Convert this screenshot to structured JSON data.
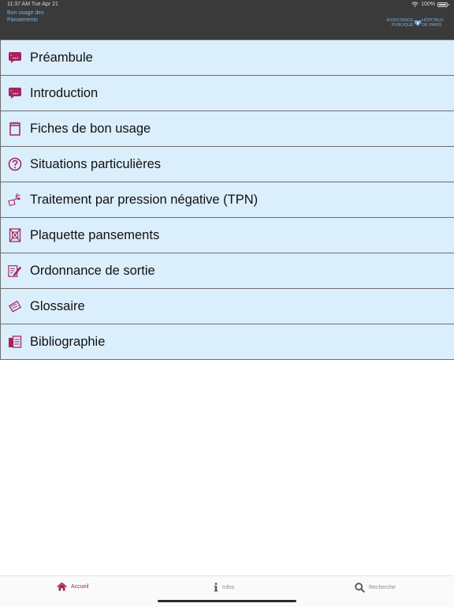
{
  "status_bar": {
    "time": "11:37 AM   Tue Apr 21",
    "battery": "100%"
  },
  "header": {
    "title": "Bon usage des Pansements",
    "logo_left": "ASSISTANCE PUBLIQUE",
    "logo_right": "HÔPITAUX DE PARIS"
  },
  "menu": {
    "items": [
      {
        "label": "Préambule",
        "icon": "speech-bubble-icon"
      },
      {
        "label": "Introduction",
        "icon": "speech-bubble-icon"
      },
      {
        "label": "Fiches de bon usage",
        "icon": "notebook-icon"
      },
      {
        "label": "Situations particulières",
        "icon": "question-circle-icon"
      },
      {
        "label": "Traitement par pression négative (TPN)",
        "icon": "pump-device-icon"
      },
      {
        "label": "Plaquette pansements",
        "icon": "bandage-icon"
      },
      {
        "label": "Ordonnance de sortie",
        "icon": "prescription-edit-icon"
      },
      {
        "label": "Glossaire",
        "icon": "tag-label-icon"
      },
      {
        "label": "Bibliographie",
        "icon": "books-icon"
      }
    ]
  },
  "tabbar": {
    "tabs": [
      {
        "label": "Accueil",
        "icon": "home-icon",
        "active": true
      },
      {
        "label": "Infos",
        "icon": "info-icon",
        "active": false
      },
      {
        "label": "Recherche",
        "icon": "search-icon",
        "active": false
      }
    ]
  },
  "colors": {
    "header_bg": "#3a3a3a",
    "menu_bg": "#dbeefb",
    "accent": "#a5245f",
    "title_blue": "#7fb2e6"
  }
}
